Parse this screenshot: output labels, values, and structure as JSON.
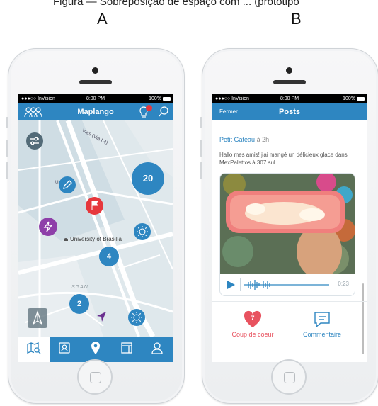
{
  "figure": {
    "caption_fragment": "Figura   — Sobreposição de espaço com ... (protótipo",
    "panel_a_letter": "A",
    "panel_b_letter": "B"
  },
  "status_bar": {
    "carrier": "●●●○○ InVision",
    "time": "8:00 PM",
    "battery": "100%"
  },
  "screen_a": {
    "title": "Maplango",
    "notification_count": "1",
    "map_labels": {
      "street": "Vias (Via L4)",
      "un": "UN",
      "university": "University of Brasília",
      "sgan": "SGAN"
    },
    "clusters": [
      "20",
      "4",
      "2"
    ],
    "colors": {
      "accent": "#2e86c1",
      "purple": "#8e3fa9",
      "red": "#e6373c",
      "map_bg": "#dfe8ec"
    },
    "tabs": [
      "map-search-icon",
      "profile-card-icon",
      "location-pin-icon",
      "notebook-icon",
      "user-icon"
    ]
  },
  "screen_b": {
    "close_label": "Fermer",
    "title": "Posts",
    "author": "Petit Gateau",
    "time_ago": "à 2h",
    "post_text": "Hallo mes amis! j'ai mangé un délicieux glace dans MexPalettos à 307 sul",
    "audio_duration": "0:23",
    "like_count": "7",
    "like_label": "Coup de coeur",
    "comment_label": "Commentaire",
    "colors": {
      "accent": "#2e86c1",
      "like": "#e8525f"
    }
  }
}
